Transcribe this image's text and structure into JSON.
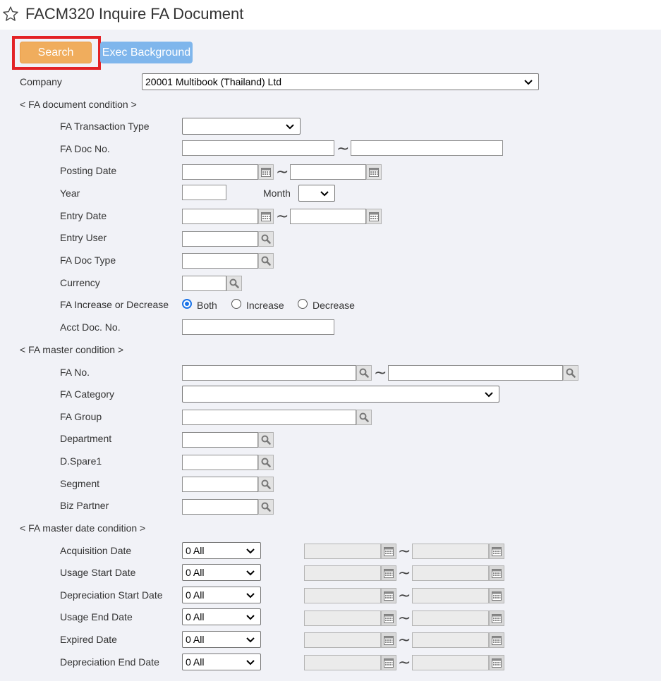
{
  "page": {
    "title": "FACM320 Inquire FA Document"
  },
  "toolbar": {
    "search_label": "Search",
    "exec_label": "Exec Background"
  },
  "company": {
    "label": "Company",
    "value": "20001 Multibook (Thailand) Ltd"
  },
  "doc_condition": {
    "heading": "< FA document condition >",
    "transaction_type_label": "FA Transaction Type",
    "transaction_type_value": "",
    "doc_no_label": "FA Doc No.",
    "posting_date_label": "Posting Date",
    "year_label": "Year",
    "month_label": "Month",
    "month_value": "",
    "entry_date_label": "Entry Date",
    "entry_user_label": "Entry User",
    "doc_type_label": "FA Doc Type",
    "currency_label": "Currency",
    "inc_dec_label": "FA Increase or Decrease",
    "inc_dec_options": [
      "Both",
      "Increase",
      "Decrease"
    ],
    "inc_dec_selected": "Both",
    "acct_doc_label": "Acct Doc. No."
  },
  "master_condition": {
    "heading": "< FA master condition >",
    "fa_no_label": "FA No.",
    "category_label": "FA Category",
    "category_value": "",
    "group_label": "FA Group",
    "department_label": "Department",
    "spare_label": "D.Spare1",
    "segment_label": "Segment",
    "biz_partner_label": "Biz Partner"
  },
  "master_date_condition": {
    "heading": "< FA master date condition >",
    "rows": [
      {
        "label": "Acquisition Date",
        "value": "0 All"
      },
      {
        "label": "Usage Start Date",
        "value": "0 All"
      },
      {
        "label": "Depreciation Start Date",
        "value": "0 All"
      },
      {
        "label": "Usage End Date",
        "value": "0 All"
      },
      {
        "label": "Expired Date",
        "value": "0 All"
      },
      {
        "label": "Depreciation End Date",
        "value": "0 All"
      }
    ]
  },
  "range_separator": "~",
  "icons": {
    "star": "star-outline-icon",
    "calendar": "calendar-icon",
    "search": "magnifier-icon",
    "chevron": "chevron-down-icon"
  },
  "colors": {
    "search_button": "#f0ad5d",
    "exec_button": "#7fb6ec",
    "highlight": "#e32226",
    "panel_background": "#f1f2f7",
    "radio_selected": "#1a73e8"
  }
}
